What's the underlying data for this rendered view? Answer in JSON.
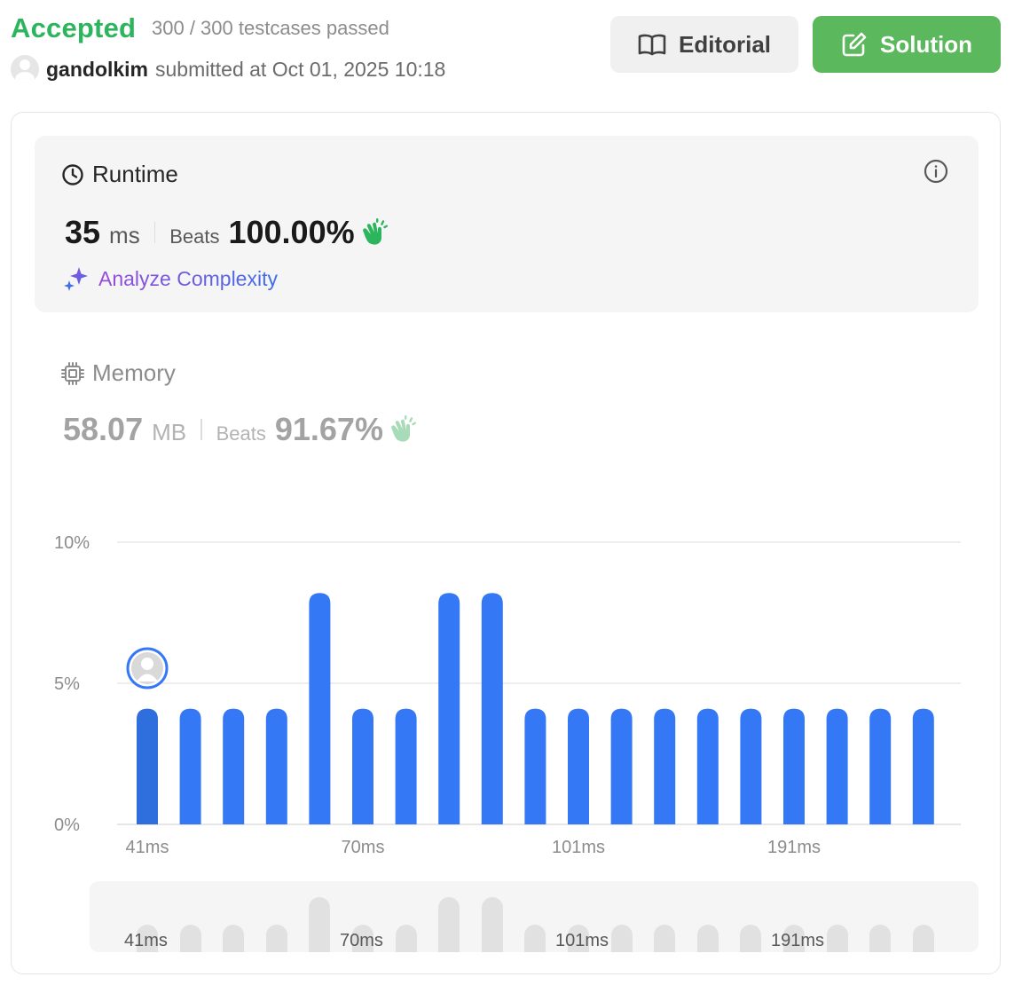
{
  "header": {
    "status": "Accepted",
    "testcases": "300 / 300 testcases passed",
    "username": "gandolkim",
    "submitted": "submitted at Oct 01, 2025 10:18",
    "editorial_label": "Editorial",
    "solution_label": "Solution"
  },
  "runtime": {
    "title": "Runtime",
    "value": "35",
    "unit": "ms",
    "beats_label": "Beats",
    "beats_value": "100.00%",
    "analyze_label": "Analyze Complexity"
  },
  "memory": {
    "title": "Memory",
    "value": "58.07",
    "unit": "MB",
    "beats_label": "Beats",
    "beats_value": "91.67%"
  },
  "colors": {
    "accepted": "#2db55d",
    "solution_button": "#5cb85c",
    "bar": "#3478f6",
    "bar_selected": "#2f6fdd",
    "overview_bar": "#e1e1e1"
  },
  "chart_data": {
    "type": "bar",
    "ylabel": "",
    "xlabel": "",
    "ylim": [
      0,
      10
    ],
    "y_ticks": [
      "0%",
      "5%",
      "10%"
    ],
    "x_tick_labels": [
      "41ms",
      "70ms",
      "101ms",
      "191ms"
    ],
    "x_tick_indices": [
      0,
      5,
      10,
      15
    ],
    "values": [
      4.1,
      4.1,
      4.1,
      4.1,
      8.2,
      4.1,
      4.1,
      8.2,
      8.2,
      4.1,
      4.1,
      4.1,
      4.1,
      4.1,
      4.1,
      4.1,
      4.1,
      4.1,
      4.1
    ],
    "highlighted_index": 0,
    "grid": true
  },
  "overview": {
    "x_tick_labels": [
      "41ms",
      "70ms",
      "101ms",
      "191ms"
    ]
  }
}
